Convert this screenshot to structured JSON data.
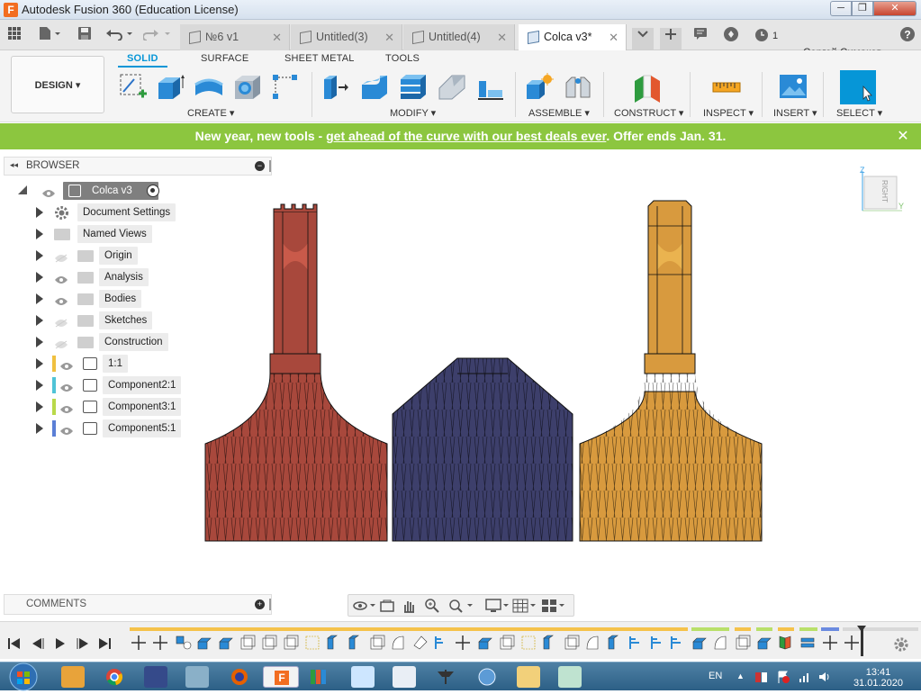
{
  "window": {
    "title": "Autodesk Fusion 360 (Education License)",
    "controls": [
      "─",
      "❐",
      "✕"
    ]
  },
  "tabs": {
    "items": [
      {
        "label": "№6 v1",
        "active": false
      },
      {
        "label": "Untitled(3)",
        "active": false
      },
      {
        "label": "Untitled(4)",
        "active": false
      },
      {
        "label": "Colca v3*",
        "active": true
      }
    ],
    "job_count": "1",
    "user_name": "Сергей Симаков"
  },
  "toolbar": {
    "workspace": "DESIGN",
    "workspace_tabs": [
      "SOLID",
      "SURFACE",
      "SHEET METAL",
      "TOOLS"
    ],
    "groups": [
      "CREATE",
      "MODIFY",
      "ASSEMBLE",
      "CONSTRUCT",
      "INSPECT",
      "INSERT",
      "SELECT"
    ]
  },
  "banner": {
    "text_before": "New year, new tools - ",
    "link_text": "get ahead of the curve with our best deals ever",
    "text_after": ". Offer ends Jan. 31.",
    "color": "#8cc63f"
  },
  "browser": {
    "title": "BROWSER",
    "root": "Colca v3",
    "items": [
      {
        "label": "Document Settings",
        "icon": "gear-icon"
      },
      {
        "label": "Named Views",
        "icon": "folder-icon"
      },
      {
        "label": "Origin",
        "icon": "folder-icon"
      },
      {
        "label": "Analysis",
        "icon": "folder-icon"
      },
      {
        "label": "Bodies",
        "icon": "folder-icon"
      },
      {
        "label": "Sketches",
        "icon": "folder-icon"
      },
      {
        "label": "Construction",
        "icon": "folder-icon"
      },
      {
        "label": "1:1",
        "icon": "component-icon",
        "color": "#f0c040"
      },
      {
        "label": "Component2:1",
        "icon": "component-icon",
        "color": "#4fc3d7"
      },
      {
        "label": "Component3:1",
        "icon": "component-icon",
        "color": "#b9d94a"
      },
      {
        "label": "Component5:1",
        "icon": "component-icon",
        "color": "#5b7fd6"
      }
    ]
  },
  "viewcube": {
    "face": "RIGHT",
    "axis_z": "Z",
    "axis_y": "Y"
  },
  "comments": {
    "title": "COMMENTS"
  },
  "models": {
    "colors": {
      "red": "#a8483c",
      "blue": "#3d3f6b",
      "gold": "#d89a3e"
    }
  },
  "taskbar": {
    "language": "EN",
    "time": "13:41",
    "date": "31.01.2020"
  }
}
